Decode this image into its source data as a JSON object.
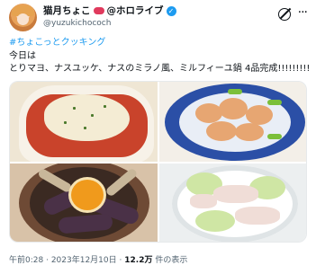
{
  "user": {
    "display_name": "猫月ちょこ",
    "display_suffix": "@ホロライブ",
    "handle": "@yuzukichococh",
    "badge_icon": "lips-emoji",
    "verified_icon": "verified-badge-icon",
    "verified_glyph": "✓"
  },
  "header_icons": {
    "grok": "grok-icon",
    "more": "more-icon",
    "more_glyph": "···"
  },
  "post": {
    "hashtag": "#ちょこっとクッキング",
    "line1": "今日は",
    "line2": "とりマヨ、ナスユッケ、ナスのミラノ風、ミルフィーユ鍋 4品完成!!!!!!!!!"
  },
  "media": {
    "photos": [
      "gratin-photo",
      "shrimp-mayo-photo",
      "eggplant-yukke-photo",
      "mille-feuille-nabe-photo"
    ]
  },
  "meta": {
    "time": "午前0:28",
    "date": "2023年12月10日",
    "views_count": "12.2万",
    "views_label": "件の表示",
    "separator": "·"
  },
  "colors": {
    "link": "#1d9bf0",
    "text": "#0f1419",
    "secondary": "#536471"
  }
}
